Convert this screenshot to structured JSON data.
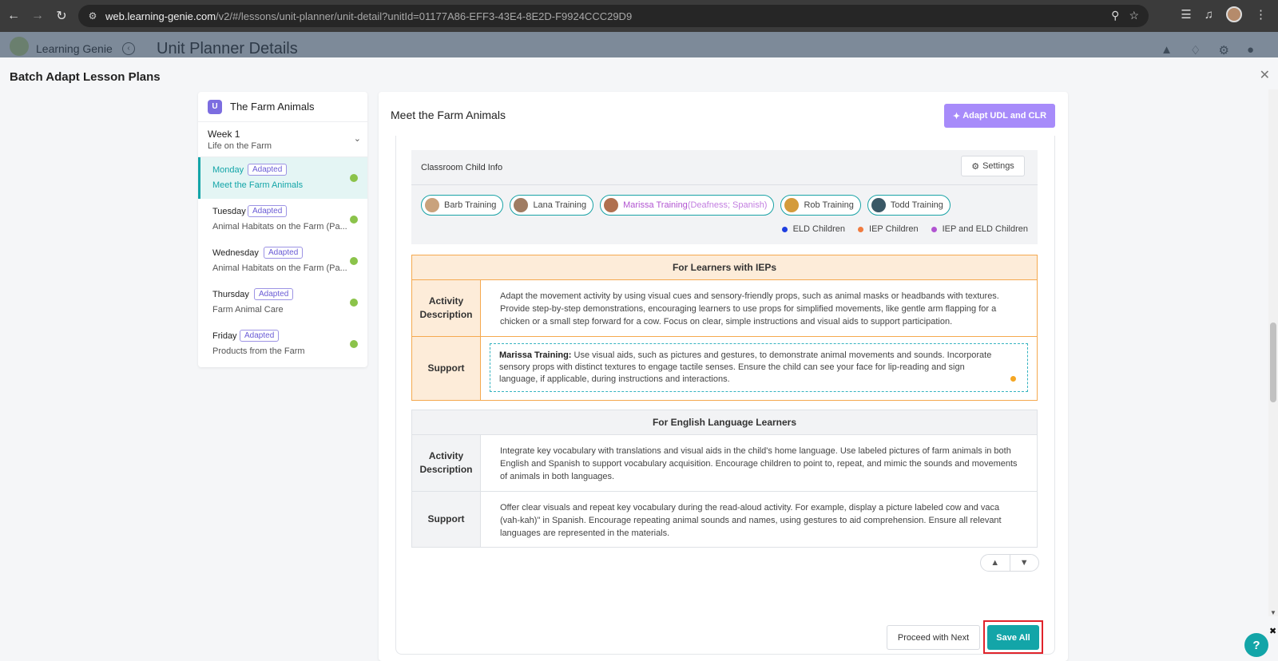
{
  "browser": {
    "url_host": "web.learning-genie.com",
    "url_path": "/v2/#/lessons/unit-planner/unit-detail?unitId=01177A86-EFF3-43E4-8E2D-F9924CCC29D9"
  },
  "app": {
    "brand": "Learning Genie",
    "page_title": "Unit Planner Details"
  },
  "modal": {
    "title": "Batch Adapt Lesson Plans"
  },
  "unit": {
    "logo_text": "U",
    "name": "The Farm Animals",
    "week_label": "Week 1",
    "week_title": "Life on the Farm",
    "days": [
      {
        "name": "Monday",
        "badge": "Adapted",
        "title": "Meet the Farm Animals"
      },
      {
        "name": "Tuesday",
        "badge": "Adapted",
        "title": "Animal Habitats on the Farm (Pa..."
      },
      {
        "name": "Wednesday",
        "badge": "Adapted",
        "title": "Animal Habitats on the Farm (Pa..."
      },
      {
        "name": "Thursday",
        "badge": "Adapted",
        "title": "Farm Animal Care"
      },
      {
        "name": "Friday",
        "badge": "Adapted",
        "title": "Products from the Farm"
      }
    ]
  },
  "lesson": {
    "title": "Meet the Farm Animals",
    "adapt_button": "Adapt UDL and CLR"
  },
  "child_info": {
    "title": "Classroom Child Info",
    "settings_label": "Settings",
    "children": [
      {
        "name": "Barb Training",
        "extra": ""
      },
      {
        "name": "Lana Training",
        "extra": ""
      },
      {
        "name": "Marissa Training",
        "extra": " (Deafness; Spanish)"
      },
      {
        "name": "Rob Training",
        "extra": ""
      },
      {
        "name": "Todd Training",
        "extra": ""
      }
    ],
    "legend": [
      {
        "label": "ELD Children",
        "color": "#1f3fe0"
      },
      {
        "label": "IEP Children",
        "color": "#f07b3f"
      },
      {
        "label": "IEP and ELD Children",
        "color": "#b154d1"
      }
    ]
  },
  "iep": {
    "heading": "For Learners with IEPs",
    "activity_label_1": "Activity",
    "activity_label_2": "Description",
    "activity_text": "Adapt the movement activity by using visual cues and sensory-friendly props, such as animal masks or headbands with textures. Provide step-by-step demonstrations, encouraging learners to use props for simplified movements, like gentle arm flapping for a chicken or a small step forward for a cow. Focus on clear, simple instructions and visual aids to support participation.",
    "support_label": "Support",
    "support_name": "Marissa Training:",
    "support_text": " Use visual aids, such as pictures and gestures, to demonstrate animal movements and sounds. Incorporate sensory props with distinct textures to engage tactile senses. Ensure the child can see your face for lip-reading and sign language, if applicable, during instructions and interactions."
  },
  "ell": {
    "heading": "For English Language Learners",
    "activity_label_1": "Activity",
    "activity_label_2": "Description",
    "activity_text": "Integrate key vocabulary with translations and visual aids in the child's home language. Use labeled pictures of farm animals in both English and Spanish to support vocabulary acquisition. Encourage children to point to, repeat, and mimic the sounds and movements of animals in both languages.",
    "support_label": "Support",
    "support_text": "Offer clear visuals and repeat key vocabulary during the read-aloud activity. For example, display a picture labeled cow and vaca (vah-kah)\" in Spanish. Encourage repeating animal sounds and names, using gestures to aid comprehension. Ensure all relevant languages are represented in the materials."
  },
  "footer": {
    "proceed_label": "Proceed with Next",
    "save_label": "Save All",
    "help_label": "?"
  },
  "colors": {
    "teal": "#13a5a8",
    "purple_button": "#a78bfa",
    "iep_border": "#f5a94f",
    "highlight_red": "#e0232b"
  }
}
